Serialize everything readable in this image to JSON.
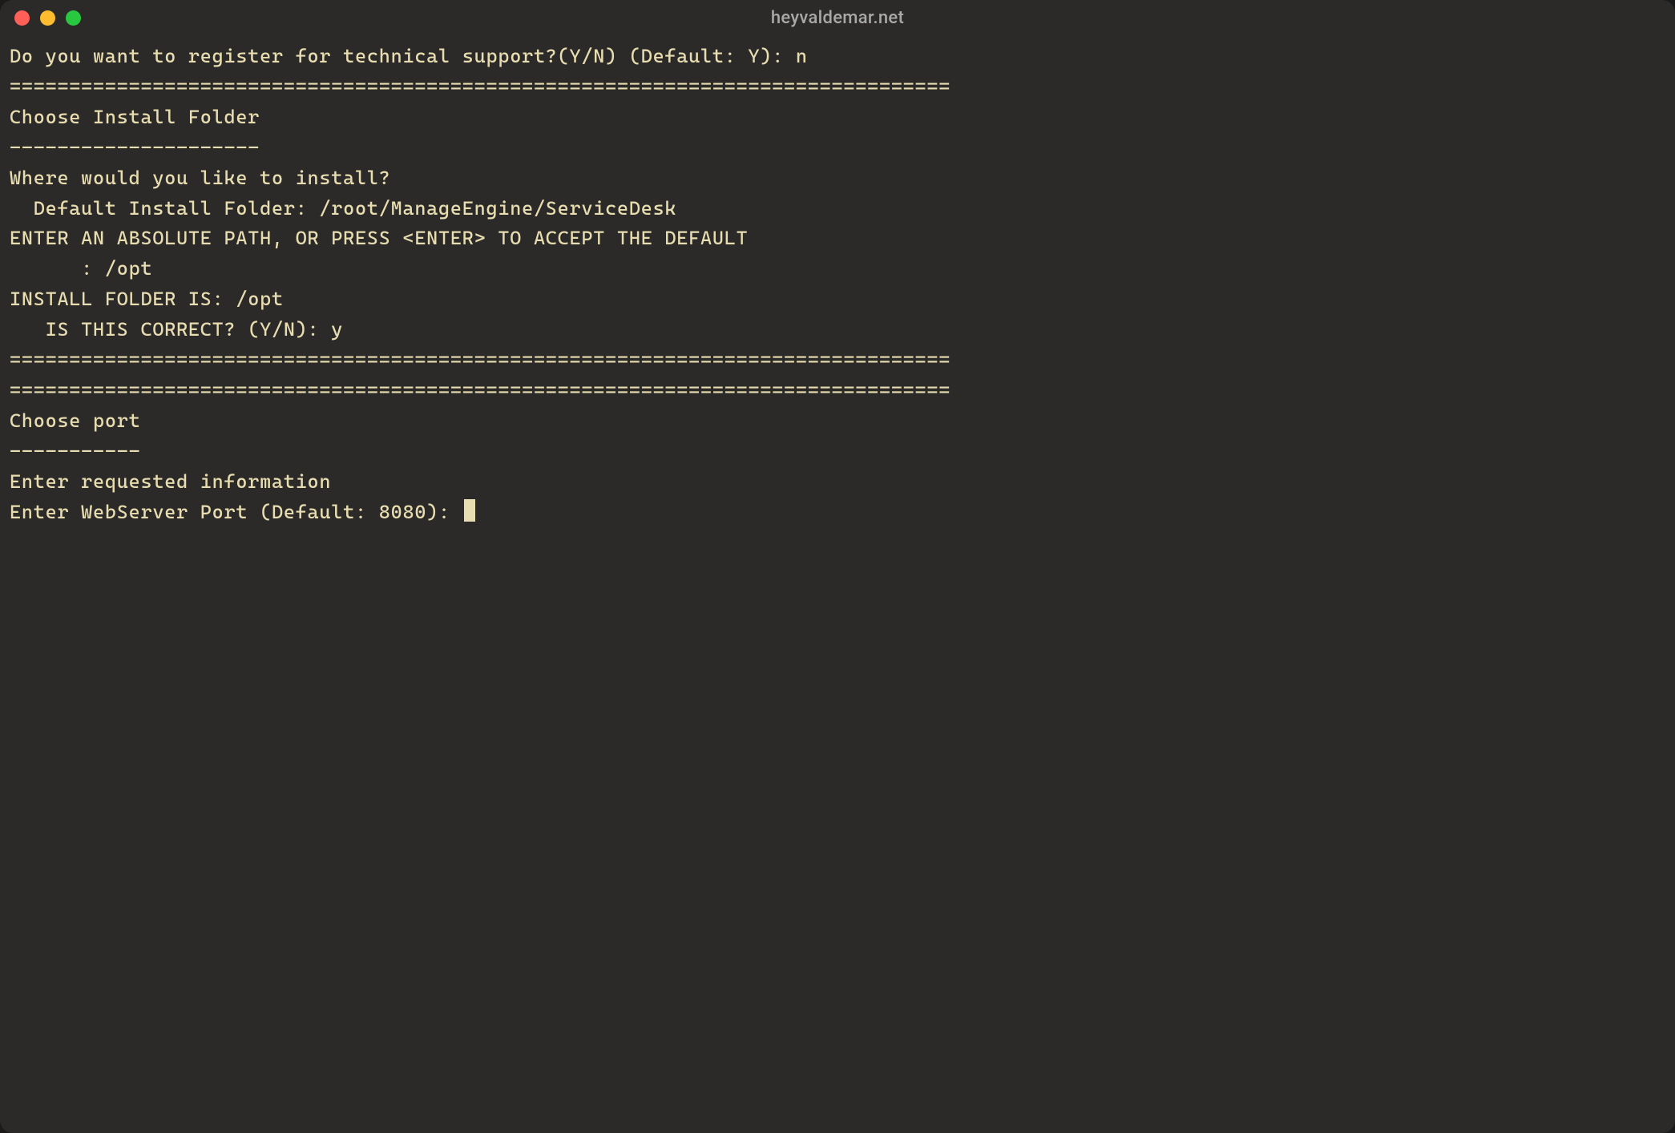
{
  "window": {
    "title": "heyvaldemar.net"
  },
  "terminal": {
    "lines": {
      "l01": "",
      "prompt_register": "Do you want to register for technical support?(Y/N) (Default: Y): n",
      "l02": "",
      "l03": "",
      "l04": "",
      "sep1": "===============================================================================",
      "heading_folder": "Choose Install Folder",
      "underline_folder": "---------------------",
      "l05": "",
      "ask_where": "Where would you like to install?",
      "l06": "",
      "default_folder": "  Default Install Folder: /root/ManageEngine/ServiceDesk",
      "l07": "",
      "enter_path_msg": "ENTER AN ABSOLUTE PATH, OR PRESS <ENTER> TO ACCEPT THE DEFAULT",
      "enter_path_input": "      : /opt",
      "l08": "",
      "install_folder_is": "INSTALL FOLDER IS: /opt",
      "is_correct": "   IS THIS CORRECT? (Y/N): y",
      "l09": "",
      "l10": "",
      "l11": "",
      "sep2": "===============================================================================",
      "l12": "",
      "l13": "",
      "l14": "",
      "l15": "",
      "sep3": "===============================================================================",
      "heading_port": "Choose port",
      "underline_port": "-----------",
      "l16": "",
      "enter_info": "Enter requested information",
      "l17": "",
      "enter_port": "Enter WebServer Port (Default: 8080): "
    }
  }
}
